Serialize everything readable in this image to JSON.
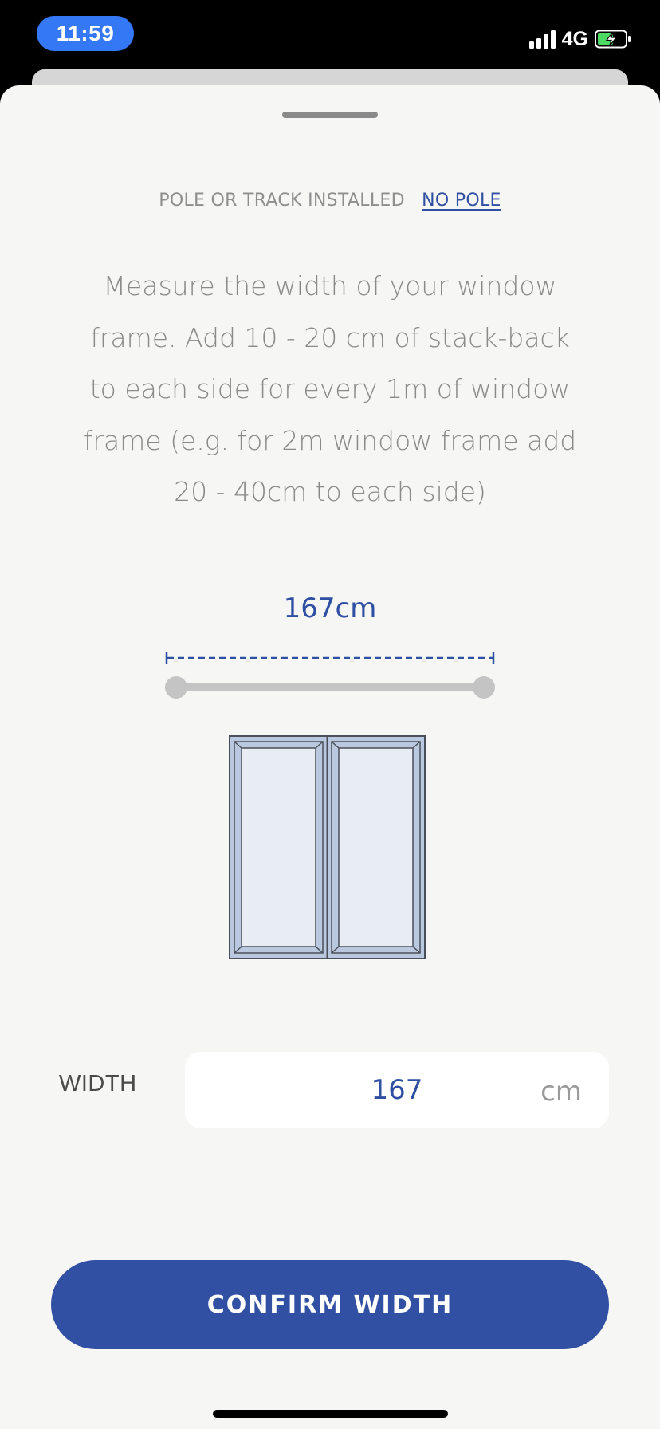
{
  "status_bar": {
    "time": "11:59",
    "network": "4G",
    "battery_level": 0.55,
    "battery_charging": true,
    "signal_bars": 4
  },
  "sheet": {
    "pole_label": "POLE OR TRACK INSTALLED",
    "pole_link": "NO POLE",
    "instructions": "Measure the width of your window frame. Add 10 - 20 cm of stack-back to each side for every 1m of window frame (e.g. for 2m window frame add 20 - 40cm to each side)",
    "measure_display": "167cm",
    "width_label": "WIDTH",
    "width_value": "167",
    "width_unit": "cm",
    "confirm_label": "CONFIRM WIDTH"
  },
  "colors": {
    "accent": "#3150a3",
    "text_blue": "#2f4fa2",
    "muted": "#8a8a8a",
    "background": "#f6f6f5",
    "time_pill": "#3478f6",
    "battery_green": "#4cd964"
  },
  "icons": [
    "signal-icon",
    "battery-charging-icon",
    "dimension-line-icon",
    "curtain-pole-icon",
    "window-icon"
  ]
}
